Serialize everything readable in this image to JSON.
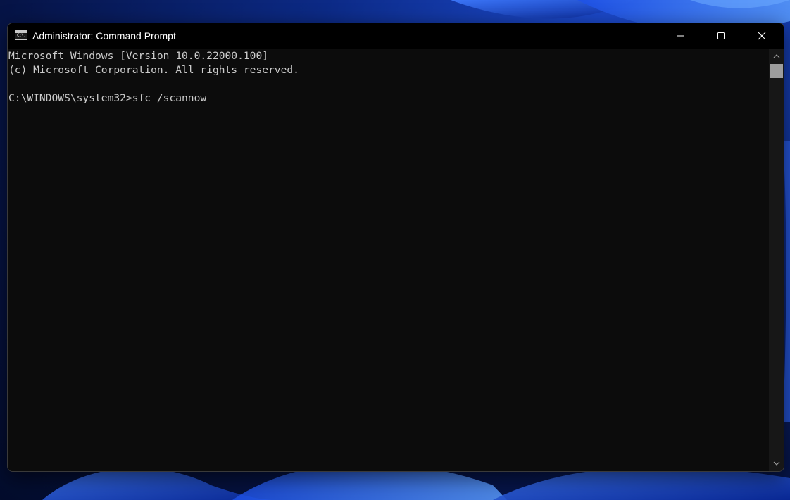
{
  "window": {
    "title": "Administrator: Command Prompt",
    "app_icon_text": "C:\\."
  },
  "caption_buttons": {
    "minimize": "minimize-icon",
    "maximize": "maximize-icon",
    "close": "close-icon"
  },
  "console": {
    "lines": [
      "Microsoft Windows [Version 10.0.22000.100]",
      "(c) Microsoft Corporation. All rights reserved.",
      "C:\\WINDOWS\\system32>sfc /scannow"
    ]
  },
  "colors": {
    "console_bg": "#0c0c0c",
    "console_fg": "#cccccc",
    "titlebar_bg": "#000000",
    "desktop_accent": "#1f4fd8"
  }
}
